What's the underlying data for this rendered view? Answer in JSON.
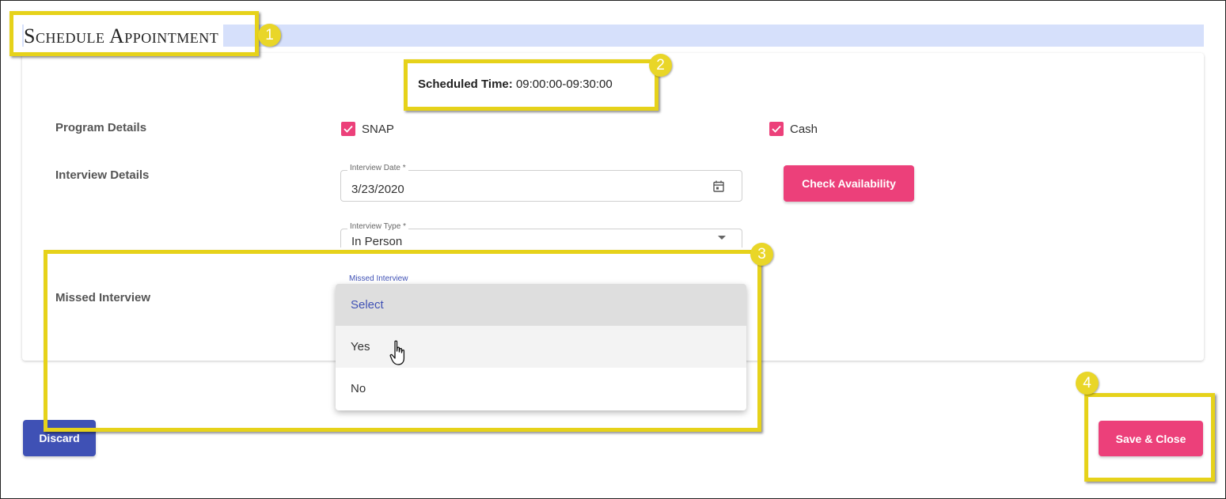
{
  "header": {
    "title": "Schedule Appointment"
  },
  "schedule": {
    "label": "Scheduled Time:",
    "value": "09:00:00-09:30:00"
  },
  "program": {
    "label": "Program Details",
    "options": [
      {
        "label": "SNAP",
        "checked": true
      },
      {
        "label": "Cash",
        "checked": true
      }
    ]
  },
  "interview": {
    "label": "Interview Details",
    "date_label": "Interview Date *",
    "date_value": "3/23/2020",
    "type_label": "Interview Type *",
    "type_value": "In Person",
    "check_button": "Check Availability"
  },
  "missed": {
    "label": "Missed Interview",
    "field_label": "Missed Interview",
    "options": [
      "Select",
      "Yes",
      "No"
    ],
    "selected": "Select",
    "hovered": "Yes"
  },
  "actions": {
    "discard": "Discard",
    "save": "Save & Close"
  },
  "callouts": [
    "1",
    "2",
    "3",
    "4"
  ],
  "colors": {
    "accent_pink": "#ec407a",
    "primary_blue": "#3f51b5",
    "highlight_yellow": "#e6d21a",
    "title_bar": "#d6e0fb"
  },
  "icons": {
    "date": "calendar-icon",
    "select": "caret-down-icon",
    "check": "checkmark-icon",
    "pointer": "hand-cursor-icon"
  }
}
